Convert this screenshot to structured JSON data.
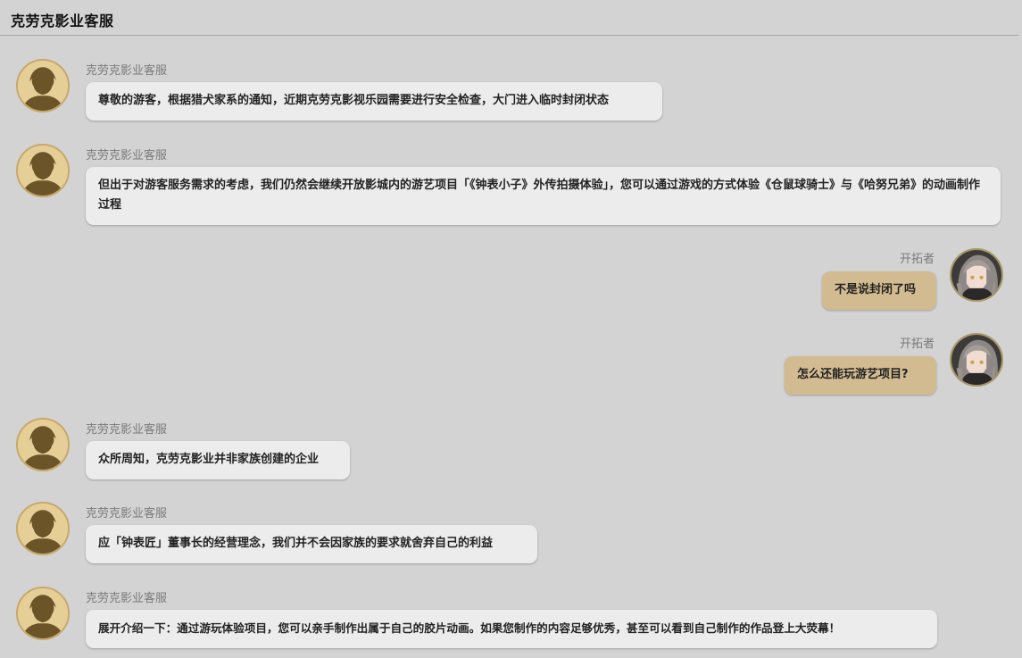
{
  "header": {
    "title": "克劳克影业客服"
  },
  "messages": [
    {
      "sender": "克劳克影业客服",
      "text": "尊敬的游客，根据猎犬家系的通知，近期克劳克影视乐园需要进行安全检查，大门进入临时封闭状态"
    },
    {
      "sender": "克劳克影业客服",
      "text": "但出于对游客服务需求的考虑，我们仍然会继续开放影城内的游艺项目「《钟表小子》外传拍摄体验」，您可以通过游戏的方式体验《仓鼠球骑士》与《哈努兄弟》的动画制作过程"
    },
    {
      "sender": "开拓者",
      "text": "不是说封闭了吗"
    },
    {
      "sender": "开拓者",
      "text": "怎么还能玩游艺项目?"
    },
    {
      "sender": "克劳克影业客服",
      "text": "众所周知，克劳克影业并非家族创建的企业"
    },
    {
      "sender": "克劳克影业客服",
      "text": "应「钟表匠」董事长的经营理念，我们并不会因家族的要求就舍弃自己的利益"
    },
    {
      "sender": "克劳克影业客服",
      "text": "展开介绍一下：通过游玩体验项目，您可以亲手制作出属于自己的胶片动画。如果您制作的内容足够优秀，甚至可以看到自己制作的作品登上大荧幕！"
    }
  ],
  "avatars": {
    "service": "silhouette-avatar-icon",
    "trailblazer": "trailblazer-portrait-icon"
  },
  "colors": {
    "background": "#d3d3d3",
    "left_bubble": "#ececec",
    "right_bubble": "#d2bb91",
    "avatar_bg": "#e6cf97",
    "silhouette": "#6b5428"
  }
}
